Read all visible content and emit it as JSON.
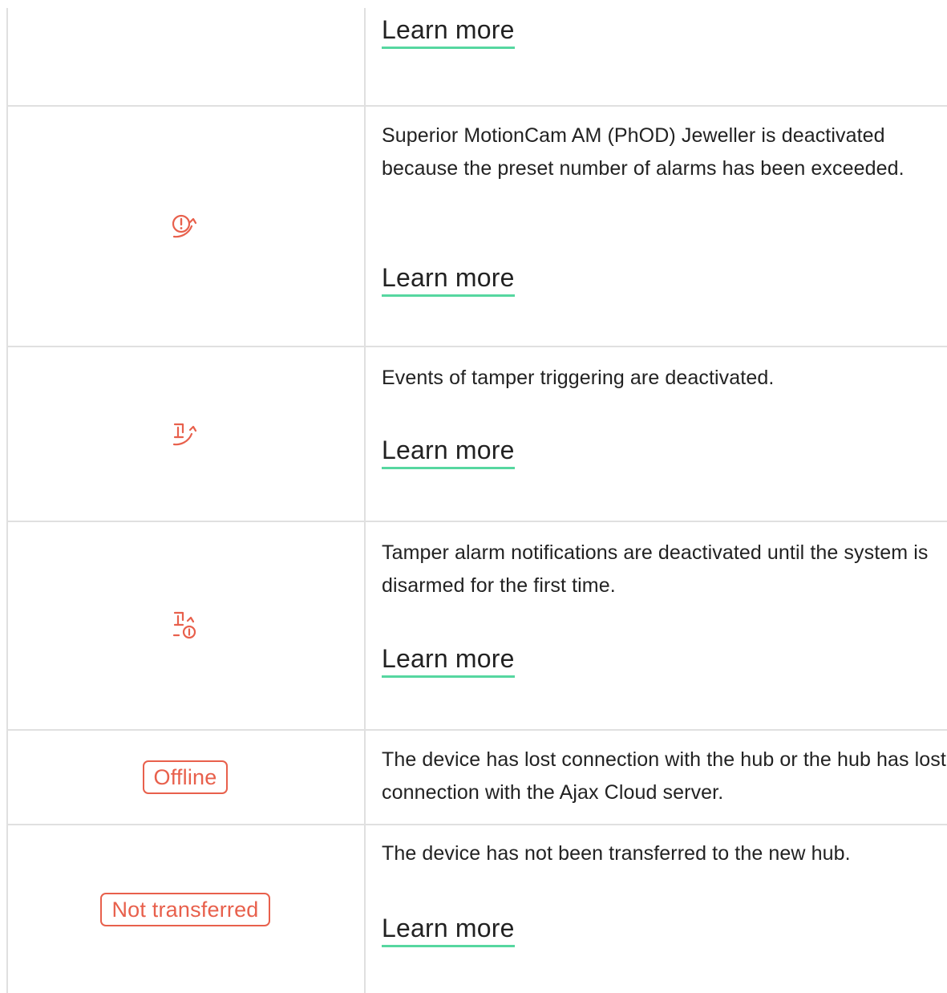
{
  "rows": [
    {
      "icon": null,
      "description": "",
      "learn_more": "Learn more"
    },
    {
      "icon": "alarm-limit-deactivated-icon",
      "description": "Superior MotionCam AM (PhOD) Jeweller is deactivated because the preset number of alarms has been exceeded.",
      "learn_more": "Learn more"
    },
    {
      "icon": "tamper-deactivated-icon",
      "description": "Events of tamper triggering are deactivated.",
      "learn_more": "Learn more"
    },
    {
      "icon": "tamper-deactivated-until-disarm-icon",
      "description": "Tamper alarm notifications are deactivated until the system is disarmed for the first time.",
      "learn_more": "Learn more"
    },
    {
      "badge": "Offline",
      "description": "The device has lost connection with the hub or the hub has lost connection with the Ajax Cloud server."
    },
    {
      "badge": "Not transferred",
      "description": "The device has not been transferred to the new hub.",
      "learn_more": "Learn more"
    }
  ],
  "colors": {
    "accent_red": "#e8604c",
    "link_underline": "#56d7a0",
    "border": "#e0e0e0",
    "text": "#222222"
  }
}
